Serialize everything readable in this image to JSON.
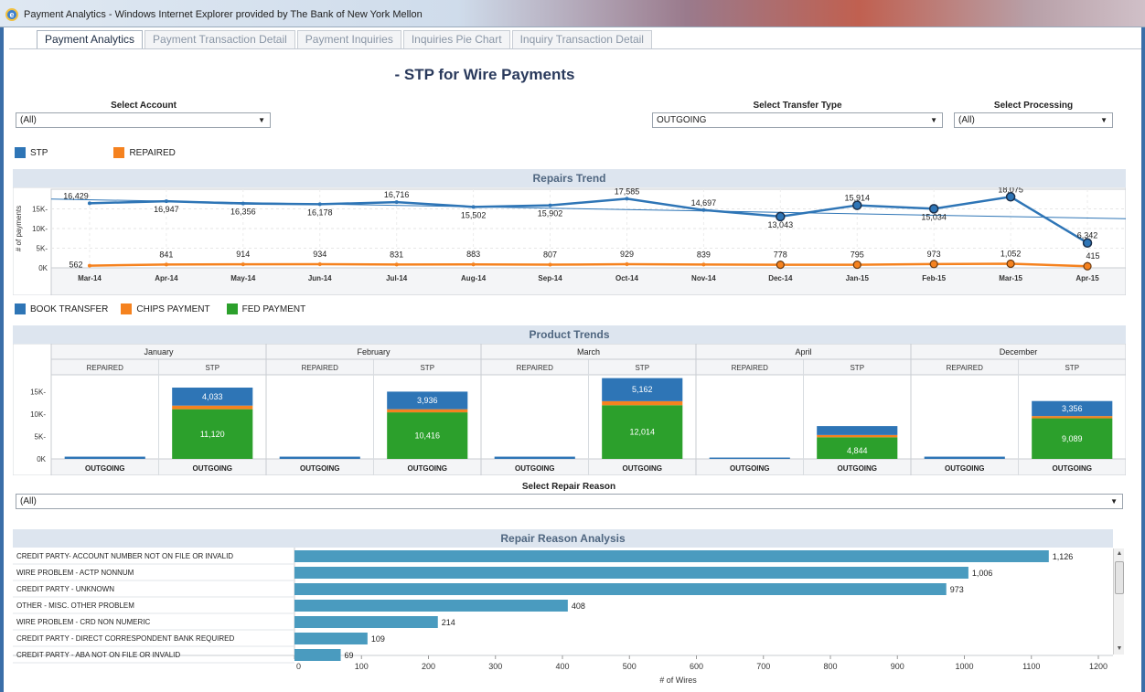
{
  "window": {
    "title": "Payment Analytics - Windows Internet Explorer provided by The Bank of New York Mellon"
  },
  "tabs": [
    "Payment Analytics",
    "Payment Transaction Detail",
    "Payment Inquiries",
    "Inquiries Pie Chart",
    "Inquiry Transaction Detail"
  ],
  "page": {
    "title": "- STP for Wire Payments"
  },
  "filters": {
    "account": {
      "label": "Select Account",
      "value": "(All)"
    },
    "transfer_type": {
      "label": "Select Transfer Type",
      "value": "OUTGOING"
    },
    "processing": {
      "label": "Select Processing",
      "value": "(All)"
    },
    "repair_reason": {
      "label": "Select Repair Reason",
      "value": "(All)"
    }
  },
  "colors": {
    "stp": "#2e75b6",
    "repaired": "#f5821f",
    "book": "#2e75b6",
    "chips": "#f5821f",
    "fed": "#2ca02c",
    "bar": "#4a9bbf"
  },
  "chart_data": [
    {
      "type": "line",
      "title": "Repairs Trend",
      "ylabel": "# of payments",
      "legend": [
        "STP",
        "REPAIRED"
      ],
      "yticks": [
        "0K",
        "5K-",
        "10K-",
        "15K-"
      ],
      "categories": [
        "Mar-14",
        "Apr-14",
        "May-14",
        "Jun-14",
        "Jul-14",
        "Aug-14",
        "Sep-14",
        "Oct-14",
        "Nov-14",
        "Dec-14",
        "Jan-15",
        "Feb-15",
        "Mar-15",
        "Apr-15"
      ],
      "series": [
        {
          "name": "STP",
          "values": [
            16429,
            16947,
            16356,
            16178,
            16716,
            15502,
            15902,
            17585,
            14697,
            13043,
            15914,
            15034,
            18075,
            6342
          ],
          "labels": [
            "16,429",
            "16,947",
            "16,356",
            "16,178",
            "16,716",
            "15,502",
            "15,902",
            "17,585",
            "14,697",
            "13,043",
            "15,914",
            "15,034",
            "18,075",
            "6,342"
          ]
        },
        {
          "name": "REPAIRED",
          "values": [
            562,
            841,
            914,
            934,
            831,
            883,
            807,
            929,
            839,
            778,
            795,
            973,
            1052,
            415
          ],
          "labels": [
            "562",
            "841",
            "914",
            "934",
            "831",
            "883",
            "807",
            "929",
            "839",
            "778",
            "795",
            "973",
            "1,052",
            "415"
          ]
        }
      ],
      "ylim": [
        0,
        20000
      ]
    },
    {
      "type": "bar",
      "title": "Product Trends",
      "legend": [
        "BOOK TRANSFER",
        "CHIPS PAYMENT",
        "FED PAYMENT"
      ],
      "yticks": [
        "0K",
        "5K-",
        "10K-",
        "15K-"
      ],
      "columns": [
        "REPAIRED",
        "STP"
      ],
      "category_label": "OUTGOING",
      "months": [
        {
          "name": "January",
          "repaired": 500,
          "stp": {
            "book": 4033,
            "chips": 800,
            "fed": 11120,
            "book_label": "4,033",
            "fed_label": "11,120"
          }
        },
        {
          "name": "February",
          "repaired": 500,
          "stp": {
            "book": 3936,
            "chips": 700,
            "fed": 10416,
            "book_label": "3,936",
            "fed_label": "10,416"
          }
        },
        {
          "name": "March",
          "repaired": 500,
          "stp": {
            "book": 5162,
            "chips": 900,
            "fed": 12014,
            "book_label": "5,162",
            "fed_label": "12,014"
          }
        },
        {
          "name": "April",
          "repaired": 300,
          "stp": {
            "book": 2000,
            "chips": 500,
            "fed": 4844,
            "book_label": "",
            "fed_label": "4,844"
          }
        },
        {
          "name": "December",
          "repaired": 500,
          "stp": {
            "book": 3356,
            "chips": 500,
            "fed": 9089,
            "book_label": "3,356",
            "fed_label": "9,089"
          }
        }
      ],
      "ylim": [
        0,
        18000
      ]
    },
    {
      "type": "bar",
      "title": "Repair Reason Analysis",
      "xlabel": "# of Wires",
      "categories": [
        "CREDIT PARTY- ACCOUNT NUMBER NOT ON FILE OR INVALID",
        "WIRE PROBLEM - ACTP NONNUM",
        "CREDIT PARTY - UNKNOWN",
        "OTHER - MISC. OTHER PROBLEM",
        "WIRE PROBLEM - CRD NON NUMERIC",
        "CREDIT PARTY - DIRECT CORRESPONDENT BANK REQUIRED",
        "CREDIT PARTY - ABA NOT ON FILE  OR INVALID"
      ],
      "values": [
        1126,
        1006,
        973,
        408,
        214,
        109,
        69
      ],
      "labels": [
        "1,126",
        "1,006",
        "973",
        "408",
        "214",
        "109",
        "69"
      ],
      "xticks": [
        0,
        100,
        200,
        300,
        400,
        500,
        600,
        700,
        800,
        900,
        1000,
        1100,
        1200
      ],
      "xlim": [
        0,
        1200
      ]
    }
  ]
}
